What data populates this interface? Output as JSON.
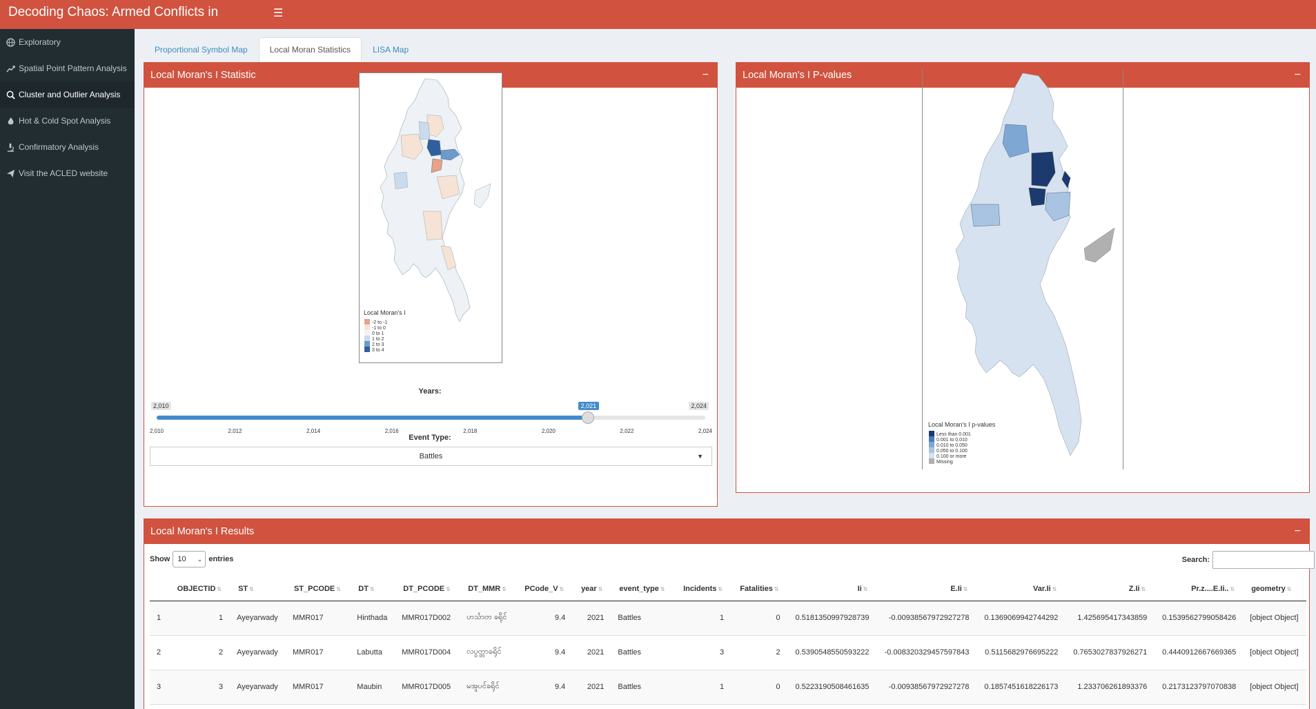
{
  "app": {
    "title": "Decoding Chaos: Armed Conflicts in Myanmar"
  },
  "sidebar": {
    "items": [
      {
        "label": "Exploratory",
        "icon": "globe-icon"
      },
      {
        "label": "Spatial Point Pattern Analysis",
        "icon": "chart-line-icon"
      },
      {
        "label": "Cluster and Outlier Analysis",
        "icon": "search-location-icon"
      },
      {
        "label": "Hot & Cold Spot Analysis",
        "icon": "fire-icon"
      },
      {
        "label": "Confirmatory Analysis",
        "icon": "microscope-icon"
      },
      {
        "label": "Visit the ACLED website",
        "icon": "paper-plane-icon"
      }
    ]
  },
  "tabs": [
    {
      "label": "Proportional Symbol Map"
    },
    {
      "label": "Local Moran Statistics"
    },
    {
      "label": "LISA Map"
    }
  ],
  "panel_left": {
    "title": "Local Moran's I Statistic",
    "collapse": "−",
    "legend": {
      "title": "Local Moran's I",
      "entries": [
        "-2 to -1",
        "-1 to 0",
        "0 to 1",
        "1 to 2",
        "2 to 3",
        "3 to 4"
      ],
      "colors": [
        "#e8a287",
        "#f7e4d8",
        "#f3f3f3",
        "#c9dbec",
        "#6b9bc9",
        "#2f5f9e"
      ]
    },
    "slider": {
      "label": "Years:",
      "min": "2,010",
      "max": "2,024",
      "value": "2,021",
      "min_value": 2010,
      "max_value": 2024,
      "current_value": 2021,
      "ticks": [
        "2,010",
        "2,012",
        "2,014",
        "2,016",
        "2,018",
        "2,020",
        "2,022",
        "2,024"
      ]
    },
    "event_type": {
      "label": "Event Type:",
      "value": "Battles"
    }
  },
  "panel_right": {
    "title": "Local Moran's I P-values",
    "collapse": "−",
    "legend": {
      "title": "Local Moran's I p-values",
      "entries": [
        "Less than 0.001",
        "0.001 to 0.010",
        "0.010 to 0.050",
        "0.050 to 0.100",
        "0.100 or more",
        "Missing"
      ],
      "colors": [
        "#1d3a6e",
        "#4a7bb7",
        "#7ea7d3",
        "#a9c4e2",
        "#d6e2f0",
        "#b0b0b0"
      ]
    }
  },
  "results": {
    "title": "Local Moran's I Results",
    "collapse": "−",
    "show_label": "Show",
    "show_value": "10",
    "entries_label": "entries",
    "search_label": "Search:",
    "columns": [
      "",
      "OBJECTID",
      "ST",
      "ST_PCODE",
      "DT",
      "DT_PCODE",
      "DT_MMR",
      "PCode_V",
      "year",
      "event_type",
      "Incidents",
      "Fatalities",
      "Ii",
      "E.Ii",
      "Var.Ii",
      "Z.Ii",
      "Pr.z....E.Ii..",
      "geometry"
    ],
    "rows": [
      [
        "1",
        "1",
        "Ayeyarwady",
        "MMR017",
        "Hinthada",
        "MMR017D002",
        "ဟင်္သာတ ခရိုင်",
        "9.4",
        "2021",
        "Battles",
        "1",
        "0",
        "0.5181350997928739",
        "-0.00938567972927278",
        "0.1369069942744292",
        "1.425695417343859",
        "0.1539562799058426",
        "[object Object]"
      ],
      [
        "2",
        "2",
        "Ayeyarwady",
        "MMR017",
        "Labutta",
        "MMR017D004",
        "လပွတ္တာခရိုင်",
        "9.4",
        "2021",
        "Battles",
        "3",
        "2",
        "0.5390548550593222",
        "-0.008320329457597843",
        "0.5115682976695222",
        "0.7653027837926271",
        "0.4440912667669365",
        "[object Object]"
      ],
      [
        "3",
        "3",
        "Ayeyarwady",
        "MMR017",
        "Maubin",
        "MMR017D005",
        "မအူပင်ခရိုင်",
        "9.4",
        "2021",
        "Battles",
        "1",
        "0",
        "0.5223190508461635",
        "-0.00938567972927278",
        "0.1857451618226173",
        "1.233706261893376",
        "0.2173123797070838",
        "[object Object]"
      ]
    ]
  }
}
